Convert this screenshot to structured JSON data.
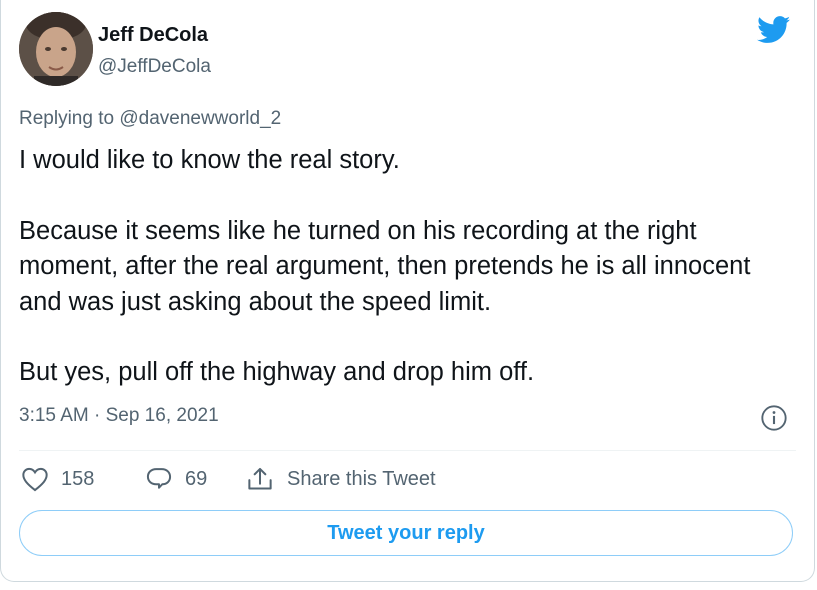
{
  "author": {
    "name": "Jeff DeCola",
    "handle": "@JeffDeCola"
  },
  "replying": {
    "prefix": "Replying to",
    "mention": "@davenewworld_2"
  },
  "tweet": {
    "paragraphs": [
      "I would like to know the real story.",
      "Because it seems like he turned on his recording at the right moment, after the real argument, then pretends he is all innocent and was just asking about the speed limit.",
      "But yes, pull off the highway and drop him off."
    ],
    "timestamp": "3:15 AM · Sep 16, 2021"
  },
  "actions": {
    "likes": "158",
    "replies": "69",
    "share_label": "Share this Tweet"
  },
  "reply_button": "Tweet your reply",
  "icons": {
    "brand": "twitter-bird-icon",
    "info": "info-icon",
    "like": "heart-icon",
    "reply": "reply-bubble-icon",
    "share": "share-icon"
  },
  "colors": {
    "brand": "#1d9bf0",
    "secondary_text": "#536471",
    "text": "#0f1419"
  }
}
